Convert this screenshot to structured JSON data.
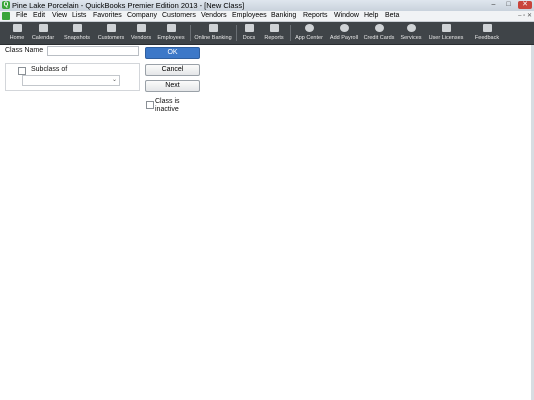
{
  "window": {
    "title": "Pine Lake Porcelain  - QuickBooks Premier Edition 2013 - [New Class]",
    "min": "–",
    "max": "□",
    "close": "✕"
  },
  "menu": {
    "items": [
      "File",
      "Edit",
      "View",
      "Lists",
      "Favorites",
      "Company",
      "Customers",
      "Vendors",
      "Employees",
      "Banking",
      "Reports",
      "Window",
      "Help",
      "Beta"
    ],
    "controls": "– ▫ ✕"
  },
  "toolbar": {
    "buttons": [
      {
        "label": "Home",
        "icon": "home-icon"
      },
      {
        "label": "Calendar",
        "icon": "calendar-icon"
      },
      {
        "label": "Snapshots",
        "icon": "snapshots-icon"
      },
      {
        "label": "Customers",
        "icon": "customers-icon"
      },
      {
        "label": "Vendors",
        "icon": "vendors-icon"
      },
      {
        "label": "Employees",
        "icon": "employees-icon"
      },
      {
        "label": "Online Banking",
        "icon": "online-banking-icon"
      },
      {
        "label": "Docs",
        "icon": "docs-icon"
      },
      {
        "label": "Reports",
        "icon": "reports-icon"
      },
      {
        "label": "App Center",
        "icon": "app-center-icon"
      },
      {
        "label": "Add Payroll",
        "icon": "add-payroll-icon"
      },
      {
        "label": "Credit Cards",
        "icon": "credit-cards-icon"
      },
      {
        "label": "Services",
        "icon": "services-icon"
      },
      {
        "label": "User Licenses",
        "icon": "user-licenses-icon"
      },
      {
        "label": "Feedback",
        "icon": "feedback-icon"
      }
    ]
  },
  "form": {
    "class_name_label": "Class Name",
    "class_name_value": "",
    "subclass_label": "Subclass of",
    "subclass_value": "",
    "ok_label": "OK",
    "cancel_label": "Cancel",
    "next_label": "Next",
    "inactive_label": "Class is inactive"
  },
  "colors": {
    "toolbar_bg": "#3f4448",
    "ok_button": "#3c78c8",
    "app_icon": "#3aa53a"
  }
}
